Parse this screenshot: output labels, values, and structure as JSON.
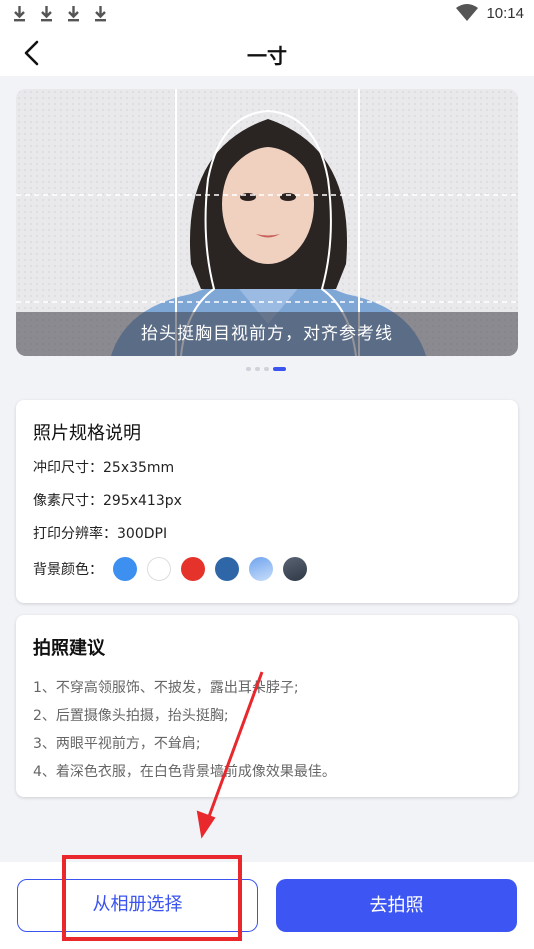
{
  "status_bar": {
    "time": "10:14",
    "icons": [
      "download-icon",
      "download-icon",
      "download-icon",
      "download-icon",
      "wifi-icon"
    ]
  },
  "header": {
    "title": "一寸",
    "back_icon": "chevron-left-icon"
  },
  "carousel": {
    "caption": "抬头挺胸目视前方，对齐参考线",
    "slide_count": 4,
    "active_index": 3
  },
  "spec_card": {
    "title": "照片规格说明",
    "print_size": "冲印尺寸：25x35mm",
    "pixel_size": "像素尺寸：295x413px",
    "resolution": "打印分辨率：300DPI",
    "bg_label": "背景颜色：",
    "bg_colors": [
      "#3d8ff0",
      "#ffffff",
      "#e5322b",
      "#2f66a8",
      "#8dbcf5",
      "#3f4b5c"
    ]
  },
  "tips_card": {
    "title": "拍照建议",
    "tips": [
      "1、不穿高领服饰、不披发，露出耳朵脖子;",
      "2、后置摄像头拍摄，抬头挺胸;",
      "3、两眼平视前方，不耸肩;",
      "4、着深色衣服，在白色背景墙前成像效果最佳。"
    ]
  },
  "actions": {
    "album_label": "从相册选择",
    "shoot_label": "去拍照"
  },
  "colors": {
    "accent": "#3b54ef",
    "annotation": "#e8282d"
  }
}
